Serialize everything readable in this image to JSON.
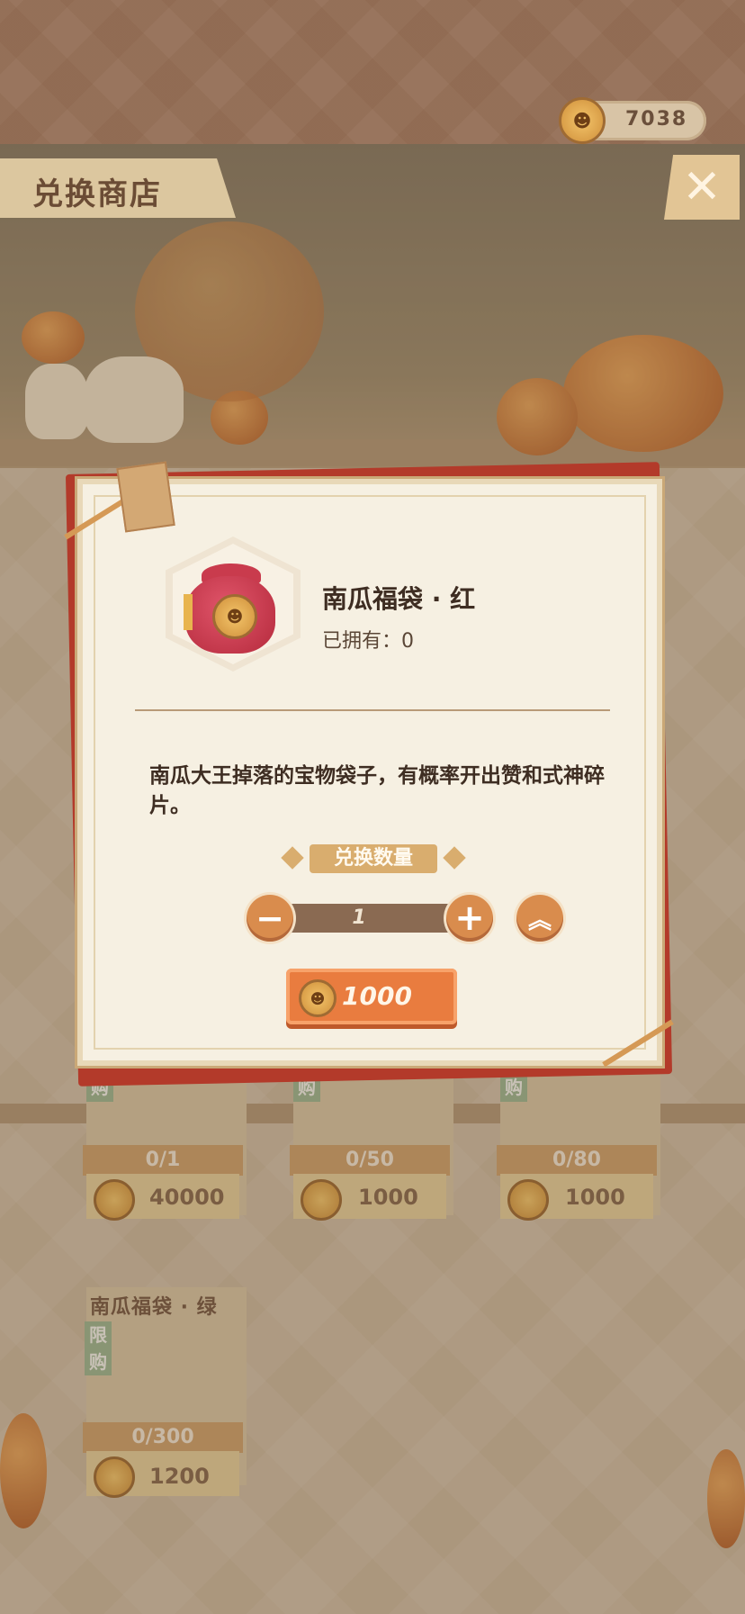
{
  "header": {
    "currency_value": "7038",
    "currency_icon": "pumpkin-coin-icon",
    "shop_title": "兑换商店",
    "close_icon": "close-icon"
  },
  "shop": {
    "cards": [
      {
        "count": "0/1",
        "price": "40000"
      },
      {
        "count": "0/50",
        "price": "1000",
        "tag": "购"
      },
      {
        "count": "0/80",
        "price": "1000",
        "tag": "购"
      },
      {
        "name": "南瓜福袋 · 绿",
        "tag": "限购",
        "count": "0/300",
        "price": "1200"
      }
    ],
    "top_row_left_tag": "购"
  },
  "modal": {
    "item_name": "南瓜福袋 · 红",
    "owned_label": "已拥有：0",
    "description": "南瓜大王掉落的宝物袋子，有概率开出赞和式神碎片。",
    "quantity_label": "兑换数量",
    "quantity": "1",
    "minus": "−",
    "plus": "+",
    "max": "︽",
    "price": "1000"
  },
  "colors": {
    "modal_back": "#b33a2a",
    "buy_button": "#e97c3f",
    "accent": "#d98c4d"
  }
}
